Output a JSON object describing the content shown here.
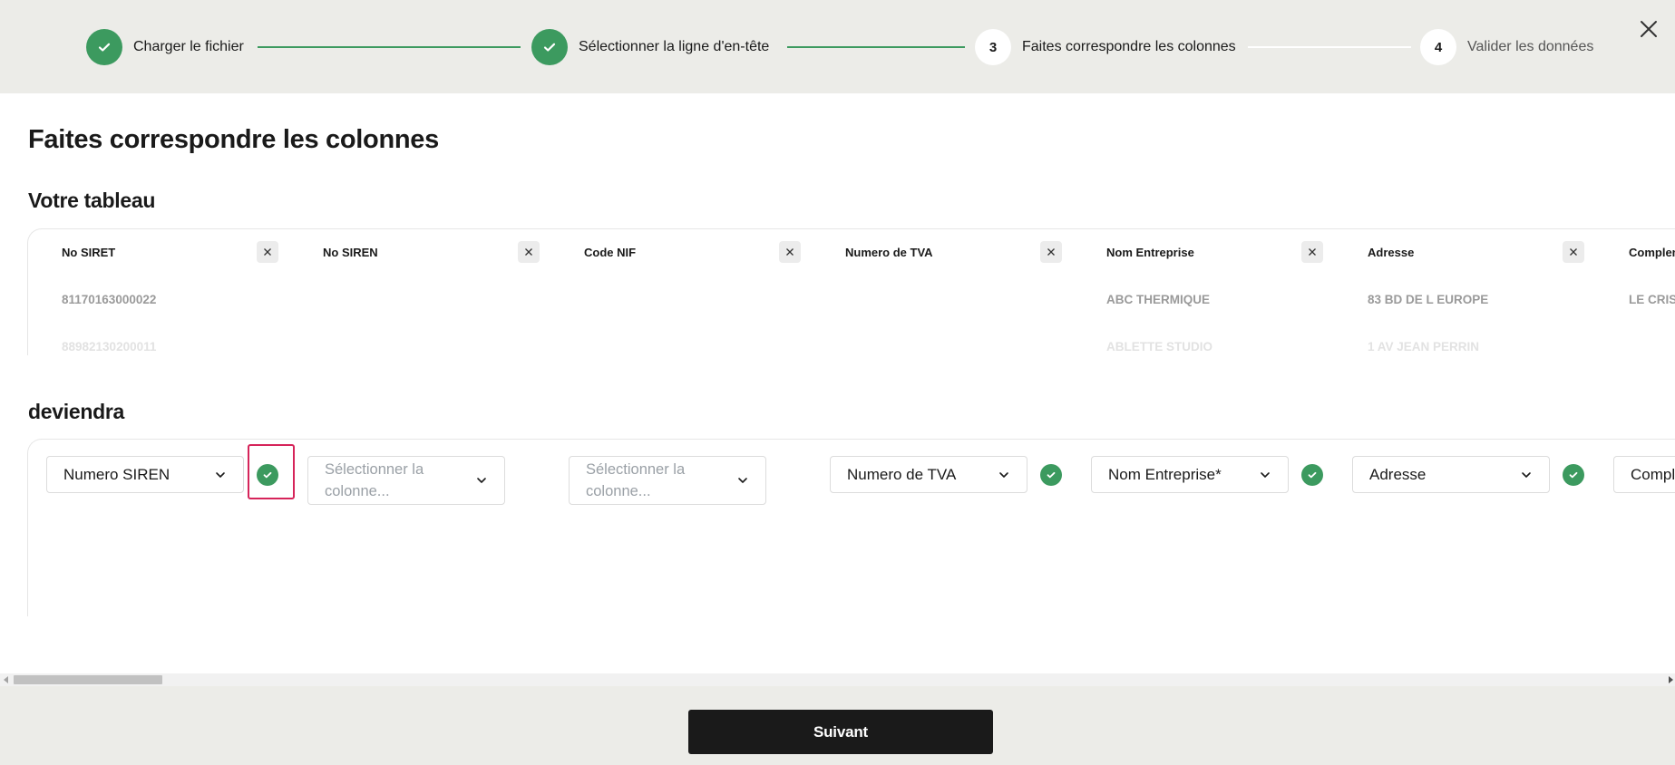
{
  "stepper": {
    "steps": [
      {
        "label": "Charger le fichier",
        "status": "done"
      },
      {
        "label": "Sélectionner la ligne d'en-tête",
        "status": "done"
      },
      {
        "label": "Faites correspondre les colonnes",
        "status": "current",
        "number": "3"
      },
      {
        "label": "Valider les données",
        "status": "todo",
        "number": "4"
      }
    ],
    "colors": {
      "done": "#3c9a5f",
      "pending": "#ffffff"
    }
  },
  "page": {
    "title": "Faites correspondre les colonnes",
    "table_section_title": "Votre tableau",
    "mapping_section_title": "deviendra"
  },
  "table": {
    "columns": [
      {
        "header": "No SIRET",
        "row1": "81170163000022",
        "row2": "88982130200011"
      },
      {
        "header": "No SIREN",
        "row1": "",
        "row2": ""
      },
      {
        "header": "Code NIF",
        "row1": "",
        "row2": ""
      },
      {
        "header": "Numero de TVA",
        "row1": "",
        "row2": ""
      },
      {
        "header": "Nom Entreprise",
        "row1": "ABC THERMIQUE",
        "row2": "ABLETTE STUDIO"
      },
      {
        "header": "Adresse",
        "row1": "83 BD DE L EUROPE",
        "row2": "1 AV JEAN PERRIN"
      },
      {
        "header": "Complem",
        "row1": "LE CRIS",
        "row2": ""
      }
    ]
  },
  "mapping": {
    "columns": [
      {
        "value": "Numero SIREN",
        "placeholder": false,
        "matched": true
      },
      {
        "value": "Sélectionner la colonne...",
        "placeholder": true,
        "matched": false
      },
      {
        "value": "Sélectionner la colonne...",
        "placeholder": true,
        "matched": false
      },
      {
        "value": "Numero de TVA",
        "placeholder": false,
        "matched": true
      },
      {
        "value": "Nom Entreprise*",
        "placeholder": false,
        "matched": true
      },
      {
        "value": "Adresse",
        "placeholder": false,
        "matched": true
      },
      {
        "value": "Comple",
        "placeholder": false,
        "matched": false
      }
    ],
    "highlight_color": "#d6245a"
  },
  "footer": {
    "next_label": "Suivant"
  }
}
